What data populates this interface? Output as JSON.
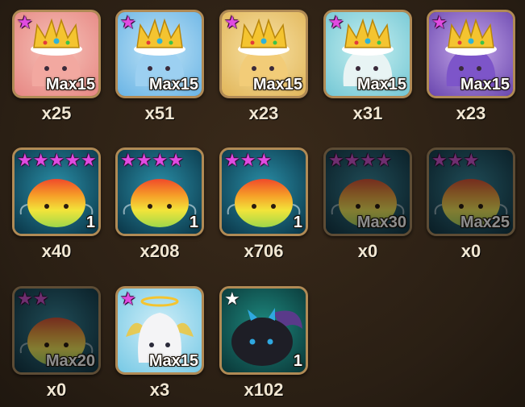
{
  "rows": [
    [
      {
        "stars": 1,
        "star_color": "#e04be0",
        "level": "Max15",
        "count": "x25",
        "art": "crown-slime",
        "bg": [
          "#f6c2b8",
          "#e78a86"
        ],
        "body": "#f2a8a0",
        "dim": false
      },
      {
        "stars": 1,
        "star_color": "#e04be0",
        "level": "Max15",
        "count": "x51",
        "art": "crown-slime",
        "bg": [
          "#bfe3f6",
          "#6fb7e6"
        ],
        "body": "#9cd0f1",
        "dim": false
      },
      {
        "stars": 1,
        "star_color": "#e04be0",
        "level": "Max15",
        "count": "x23",
        "art": "crown-slime",
        "bg": [
          "#f8e2a4",
          "#e2b85e"
        ],
        "body": "#f2cc78",
        "dim": false
      },
      {
        "stars": 1,
        "star_color": "#e04be0",
        "level": "Max15",
        "count": "x31",
        "art": "crown-slime",
        "bg": [
          "#c7f0f0",
          "#78c9d6"
        ],
        "body": "#e8f4f4",
        "dim": false
      },
      {
        "stars": 1,
        "star_color": "#e04be0",
        "level": "Max15",
        "count": "x23",
        "art": "crown-slime",
        "bg": [
          "#c7a9ea",
          "#6f4cb2"
        ],
        "body": "#7d55c9",
        "dim": false
      }
    ],
    [
      {
        "stars": 5,
        "star_color": "#e04be0",
        "level": "1",
        "count": "x40",
        "art": "rainbow-slime",
        "bg": [
          "#2a8fa8",
          "#0c3a4c"
        ],
        "dim": false
      },
      {
        "stars": 4,
        "star_color": "#e04be0",
        "level": "1",
        "count": "x208",
        "art": "rainbow-slime",
        "bg": [
          "#2a8fa8",
          "#0c3a4c"
        ],
        "dim": false
      },
      {
        "stars": 3,
        "star_color": "#e04be0",
        "level": "1",
        "count": "x706",
        "art": "rainbow-slime",
        "bg": [
          "#2a8fa8",
          "#0c3a4c"
        ],
        "dim": false
      },
      {
        "stars": 4,
        "star_color": "#e04be0",
        "level": "Max30",
        "count": "x0",
        "art": "rainbow-slime",
        "bg": [
          "#2a8fa8",
          "#0c3a4c"
        ],
        "dim": true
      },
      {
        "stars": 3,
        "star_color": "#e04be0",
        "level": "Max25",
        "count": "x0",
        "art": "rainbow-slime",
        "bg": [
          "#2a8fa8",
          "#0c3a4c"
        ],
        "dim": true
      }
    ],
    [
      {
        "stars": 2,
        "star_color": "#e04be0",
        "level": "Max20",
        "count": "x0",
        "art": "rainbow-slime",
        "bg": [
          "#2a8fa8",
          "#0c3a4c"
        ],
        "dim": true
      },
      {
        "stars": 1,
        "star_color": "#e04be0",
        "level": "Max15",
        "count": "x3",
        "art": "angel-slime",
        "bg": [
          "#cfeef8",
          "#7ccbe6"
        ],
        "dim": false
      },
      {
        "stars": 1,
        "star_color": "#ffffff",
        "level": "1",
        "count": "x102",
        "art": "devil-slime",
        "bg": [
          "#1e8a80",
          "#0b3a3a"
        ],
        "dim": false
      }
    ]
  ]
}
